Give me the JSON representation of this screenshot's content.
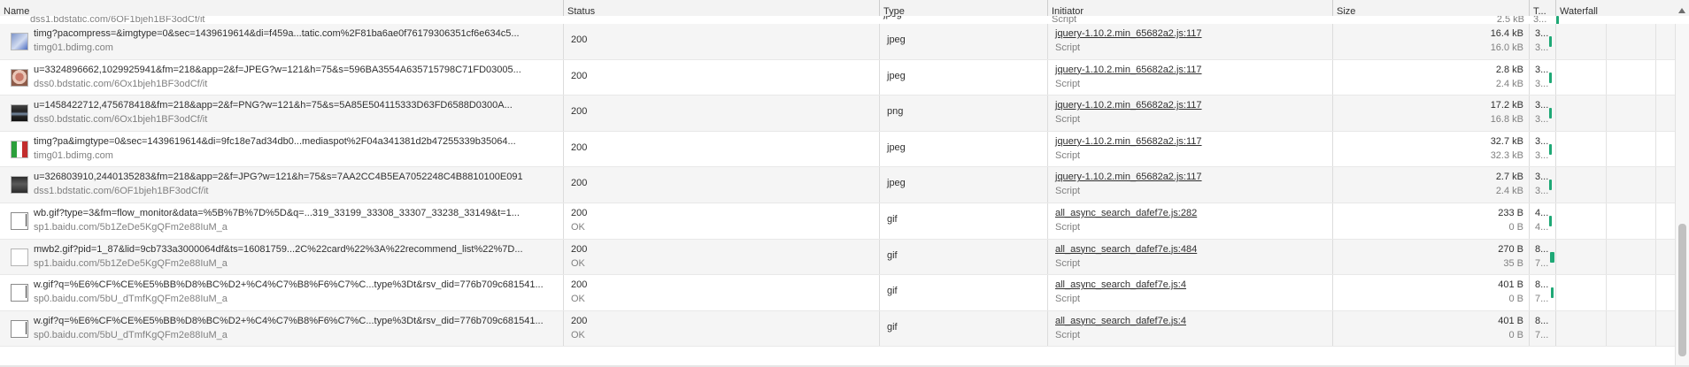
{
  "columns": {
    "name": "Name",
    "status": "Status",
    "type": "Type",
    "initiator": "Initiator",
    "size": "Size",
    "time": "T...",
    "waterfall": "Waterfall"
  },
  "top_partial": {
    "domain": "dss1.bdstatic.com/6OF1bjeh1BF3odCf/it",
    "type": "jpeg",
    "initiator_type": "Script",
    "size_resource": "2.5 kB",
    "time": "3..."
  },
  "rows": [
    {
      "icon": "image-thumbnail-icon",
      "name": "timg?pacompress=&imgtype=0&sec=1439619614&di=f459a...tatic.com%2F81ba6ae0f76179306351cf6e634c5...",
      "domain": "timg01.bdimg.com",
      "status": "200",
      "status_text": "",
      "type": "jpeg",
      "initiator": "jquery-1.10.2.min_65682a2.js:117",
      "initiator_type": "Script",
      "size_transferred": "16.4 kB",
      "size_resource": "16.0 kB",
      "time": "3...",
      "time2": "3..."
    },
    {
      "icon": "image-thumbnail-icon",
      "name": "u=3324896662,1029925941&fm=218&app=2&f=JPEG?w=121&h=75&s=596BA3554A635715798C71FD03005...",
      "domain": "dss0.bdstatic.com/6Ox1bjeh1BF3odCf/it",
      "status": "200",
      "status_text": "",
      "type": "jpeg",
      "initiator": "jquery-1.10.2.min_65682a2.js:117",
      "initiator_type": "Script",
      "size_transferred": "2.8 kB",
      "size_resource": "2.4 kB",
      "time": "3...",
      "time2": "3..."
    },
    {
      "icon": "image-thumbnail-icon",
      "name": "u=1458422712,475678418&fm=218&app=2&f=PNG?w=121&h=75&s=5A85E504115333D63FD6588D0300A...",
      "domain": "dss0.bdstatic.com/6Ox1bjeh1BF3odCf/it",
      "status": "200",
      "status_text": "",
      "type": "png",
      "initiator": "jquery-1.10.2.min_65682a2.js:117",
      "initiator_type": "Script",
      "size_transferred": "17.2 kB",
      "size_resource": "16.8 kB",
      "time": "3...",
      "time2": "3..."
    },
    {
      "icon": "image-thumbnail-icon",
      "name": "timg?pa&imgtype=0&sec=1439619614&di=9fc18e7ad34db0...mediaspot%2F04a341381d2b47255339b35064...",
      "domain": "timg01.bdimg.com",
      "status": "200",
      "status_text": "",
      "type": "jpeg",
      "initiator": "jquery-1.10.2.min_65682a2.js:117",
      "initiator_type": "Script",
      "size_transferred": "32.7 kB",
      "size_resource": "32.3 kB",
      "time": "3...",
      "time2": "3..."
    },
    {
      "icon": "image-thumbnail-icon",
      "name": "u=326803910,2440135283&fm=218&app=2&f=JPG?w=121&h=75&s=7AA2CC4B5EA7052248C4B8810100E091",
      "domain": "dss1.bdstatic.com/6OF1bjeh1BF3odCf/it",
      "status": "200",
      "status_text": "",
      "type": "jpeg",
      "initiator": "jquery-1.10.2.min_65682a2.js:117",
      "initiator_type": "Script",
      "size_transferred": "2.7 kB",
      "size_resource": "2.4 kB",
      "time": "3...",
      "time2": "3..."
    },
    {
      "icon": "broken-image-icon",
      "name": "wb.gif?type=3&fm=flow_monitor&data=%5B%7B%7D%5D&q=...319_33199_33308_33307_33238_33149&t=1...",
      "domain": "sp1.baidu.com/5b1ZeDe5KgQFm2e88IuM_a",
      "status": "200",
      "status_text": "OK",
      "type": "gif",
      "initiator": "all_async_search_dafef7e.js:282",
      "initiator_type": "Script",
      "size_transferred": "233 B",
      "size_resource": "0 B",
      "time": "4...",
      "time2": "4..."
    },
    {
      "icon": "blank-image-icon",
      "name": "mwb2.gif?pid=1_87&lid=9cb733a3000064df&ts=16081759...2C%22card%22%3A%22recommend_list%22%7D...",
      "domain": "sp1.baidu.com/5b1ZeDe5KgQFm2e88IuM_a",
      "status": "200",
      "status_text": "OK",
      "type": "gif",
      "initiator": "all_async_search_dafef7e.js:484",
      "initiator_type": "Script",
      "size_transferred": "270 B",
      "size_resource": "35 B",
      "time": "8...",
      "time2": "7..."
    },
    {
      "icon": "broken-image-icon",
      "name": "w.gif?q=%E6%CF%CE%E5%BB%D8%BC%D2+%C4%C7%B8%F6%C7%C...type%3Dt&rsv_did=776b709c681541...",
      "domain": "sp0.baidu.com/5bU_dTmfKgQFm2e88IuM_a",
      "status": "200",
      "status_text": "OK",
      "type": "gif",
      "initiator": "all_async_search_dafef7e.js:4",
      "initiator_type": "Script",
      "size_transferred": "401 B",
      "size_resource": "0 B",
      "time": "8...",
      "time2": "7..."
    },
    {
      "icon": "broken-image-icon",
      "name": "w.gif?q=%E6%CF%CE%E5%BB%D8%BC%D2+%C4%C7%B8%F6%C7%C...type%3Dt&rsv_did=776b709c681541...",
      "domain": "sp0.baidu.com/5bU_dTmfKgQFm2e88IuM_a",
      "status": "200",
      "status_text": "OK",
      "type": "gif",
      "initiator": "all_async_search_dafef7e.js:4",
      "initiator_type": "Script",
      "size_transferred": "401 B",
      "size_resource": "0 B",
      "time": "8...",
      "time2": "7..."
    }
  ],
  "colors": {
    "header_bg": "#f3f3f3",
    "alt_row_bg": "#f5f5f5",
    "waterfall_bar": "#1fa876"
  }
}
